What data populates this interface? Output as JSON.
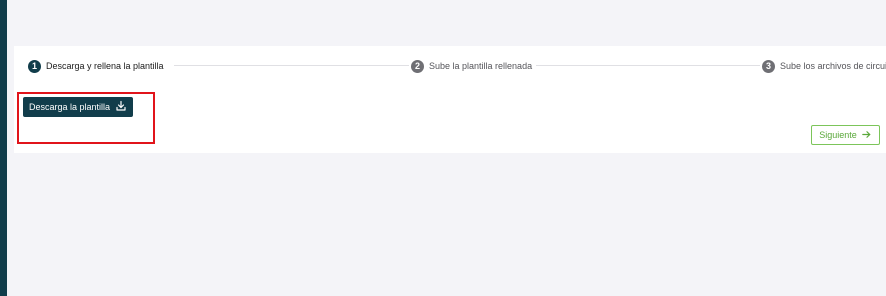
{
  "stepper": {
    "steps": [
      {
        "number": "1",
        "label": "Descarga y rellena la plantilla",
        "state": "active"
      },
      {
        "number": "2",
        "label": "Sube la plantilla rellenada",
        "state": "inactive"
      },
      {
        "number": "3",
        "label": "Sube los archivos de circuitos",
        "state": "inactive"
      }
    ]
  },
  "actions": {
    "download_label": "Descarga la plantilla",
    "download_icon": "download-icon",
    "next_label": "Siguiente",
    "next_icon": "arrow-right-icon"
  },
  "colors": {
    "primary": "#113d4b",
    "accent_green": "#5aa83a",
    "highlight": "#e1141b"
  }
}
